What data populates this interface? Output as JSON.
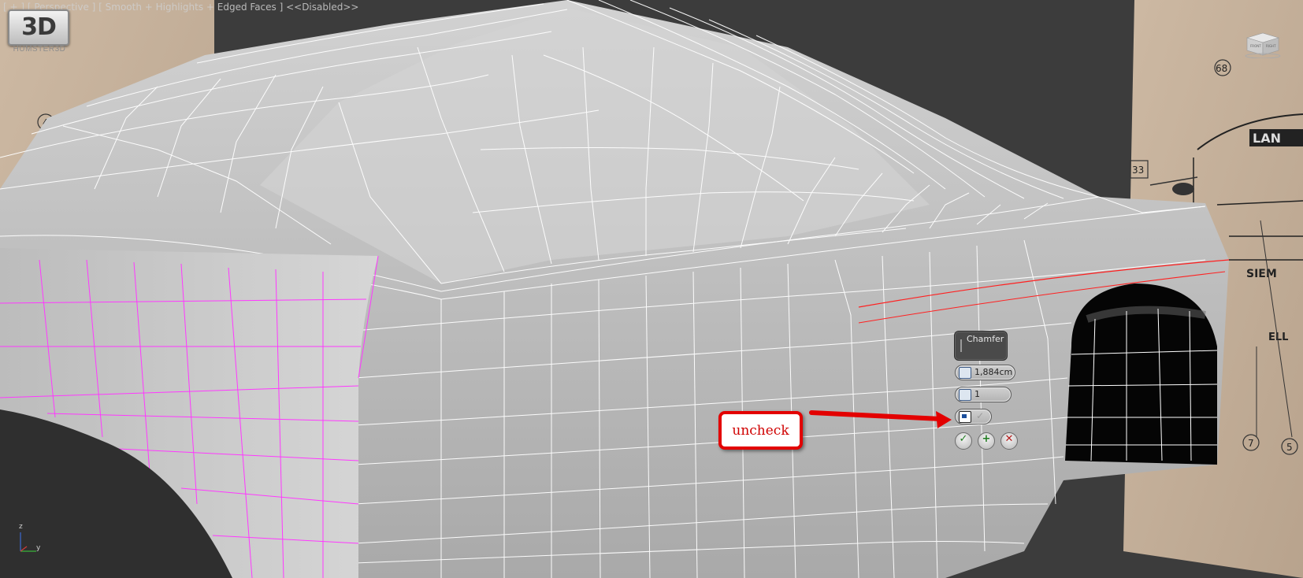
{
  "viewport": {
    "label": "[ + ] [ Perspective ] [ Smooth + Highlights + Edged Faces ] <<Disabled>>"
  },
  "watermark": {
    "logo_text": "3D",
    "logo_sub": "HUMSTER3D"
  },
  "blueprint": {
    "callout_numbers": [
      "4",
      "33",
      "68",
      "33",
      "7",
      "5"
    ],
    "car_text": [
      "LAN",
      "SIEM",
      "ELL"
    ]
  },
  "viewcube": {
    "faces": [
      "FRONT",
      "RIGHT"
    ]
  },
  "axis": {
    "labels": [
      "z",
      "y"
    ]
  },
  "chamfer_caddy": {
    "title": "Chamfer",
    "amount": "1,884cm",
    "segments": "1",
    "smooth_checkbox_checked": true,
    "icons": [
      "chamfer-amount-icon",
      "segments-icon",
      "smooth-toggle-icon"
    ],
    "buttons": {
      "ok": "✓",
      "apply": "+",
      "cancel": "✕"
    }
  },
  "annotation": {
    "text": "uncheck",
    "color": "#e30000"
  },
  "colors": {
    "viewport_bg": "#3c3c3c",
    "mesh": "#bfbfbf",
    "wire": "#ffffff",
    "selected_wire": "#ff38ff",
    "selected_edge": "#ff2020",
    "blueprint": "#c7b29c"
  }
}
